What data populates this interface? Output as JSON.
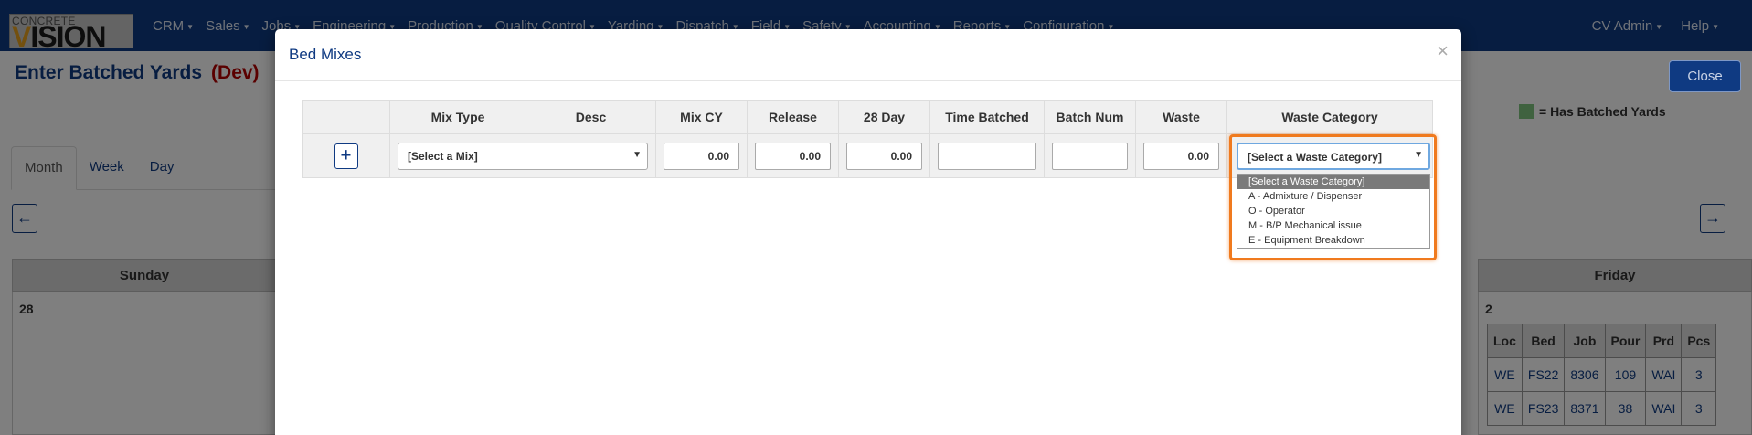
{
  "logo": {
    "top_text": "CONCRETE",
    "main_text": "VISION"
  },
  "nav": {
    "items": [
      "CRM",
      "Sales",
      "Jobs",
      "Engineering",
      "Production",
      "Quality Control",
      "Yarding",
      "Dispatch",
      "Field",
      "Safety",
      "Accounting",
      "Reports",
      "Configuration"
    ],
    "user": "CV Admin",
    "help": "Help"
  },
  "page": {
    "title": "Enter Batched Yards",
    "env": "(Dev)",
    "legend": "= Has Batched Yards",
    "close_label": "Close",
    "tabs": [
      "Month",
      "Week",
      "Day"
    ],
    "prev_icon": "←",
    "next_icon": "→",
    "calendar": {
      "day_sunday": "Sunday",
      "day_friday": "Friday",
      "sunday_date": "28",
      "friday_date": "2",
      "friday_table": {
        "headers": [
          "Loc",
          "Bed",
          "Job",
          "Pour",
          "Prd",
          "Pcs"
        ],
        "rows": [
          [
            "WE",
            "FS22",
            "8306",
            "109",
            "WAI",
            "3"
          ],
          [
            "WE",
            "FS23",
            "8371",
            "38",
            "WAI",
            "3"
          ]
        ]
      }
    },
    "colors": {
      "navbar": "#0f3a82",
      "accent_highlight": "#f07a1e",
      "legend_swatch": "#7fc47f"
    }
  },
  "modal": {
    "title": "Bed Mixes",
    "close": "×",
    "headers": [
      "",
      "Mix Type",
      "Desc",
      "Mix CY",
      "Release",
      "28 Day",
      "Time Batched",
      "Batch Num",
      "Waste",
      "Waste Category"
    ],
    "row": {
      "add": "+",
      "mix_select": "[Select a Mix]",
      "mix_cy": "0.00",
      "release": "0.00",
      "day28": "0.00",
      "time_batched": "",
      "batch_num": "",
      "waste": "0.00",
      "waste_category": "[Select a Waste Category]"
    },
    "waste_options": [
      "[Select a Waste Category]",
      "A - Admixture / Dispenser",
      "O - Operator",
      "M - B/P Mechanical issue",
      "E - Equipment Breakdown"
    ]
  }
}
